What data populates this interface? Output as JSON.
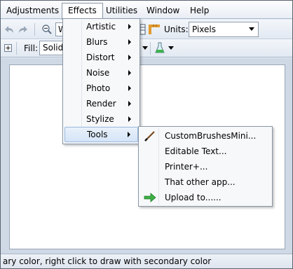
{
  "menubar": {
    "items": [
      {
        "label": "Adjustments"
      },
      {
        "label": "Effects"
      },
      {
        "label": "Utilities"
      },
      {
        "label": "Window"
      },
      {
        "label": "Help"
      }
    ]
  },
  "toolbar": {
    "zoom_value": "W",
    "units_label": "Units:",
    "units_value": "Pixels",
    "fill_label": "Fill:",
    "fill_value": "Solid"
  },
  "effects_menu": {
    "items": [
      {
        "label": "Artistic"
      },
      {
        "label": "Blurs"
      },
      {
        "label": "Distort"
      },
      {
        "label": "Noise"
      },
      {
        "label": "Photo"
      },
      {
        "label": "Render"
      },
      {
        "label": "Stylize"
      },
      {
        "label": "Tools"
      }
    ]
  },
  "tools_submenu": {
    "items": [
      {
        "label": "CustomBrushesMini...",
        "icon": "brush-icon"
      },
      {
        "label": "Editable Text..."
      },
      {
        "label": "Printer+..."
      },
      {
        "label": "That other app..."
      },
      {
        "label": "Upload to......",
        "icon": "green-arrow-icon"
      }
    ]
  },
  "statusbar": {
    "text": "ary color, right click to draw with secondary color"
  }
}
